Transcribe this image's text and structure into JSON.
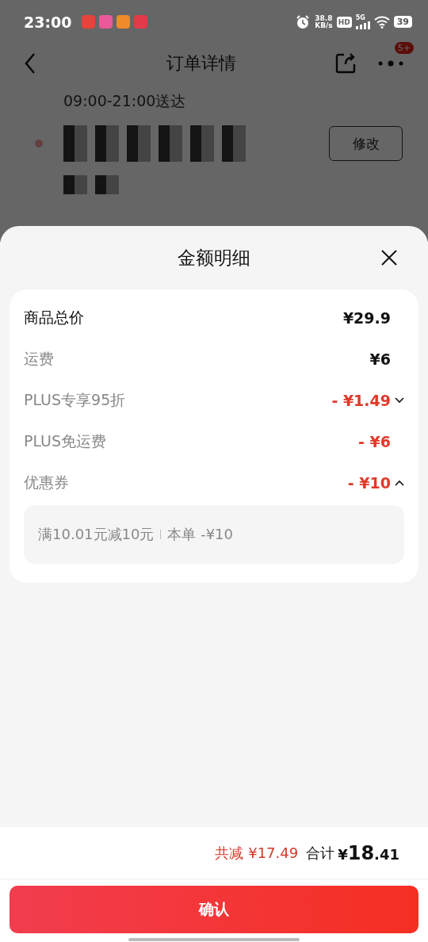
{
  "status_bar": {
    "time": "23:00",
    "speed_value": "38.8",
    "speed_unit": "KB/s",
    "hd": "HD",
    "network": "5G",
    "battery": "39"
  },
  "header": {
    "title": "订单详情",
    "badge": "5+"
  },
  "background": {
    "delivery_time": "09:00-21:00送达",
    "edit_button": "修改"
  },
  "sheet": {
    "title": "金额明细",
    "rows": [
      {
        "label": "商品总价",
        "amount": "¥29.9",
        "kind": "total",
        "discount": false
      },
      {
        "label": "运费",
        "amount": "¥6",
        "kind": "plain",
        "discount": false
      },
      {
        "label": "PLUS专享95折",
        "amount": "- ¥1.49",
        "kind": "expandable",
        "discount": true,
        "expanded": false
      },
      {
        "label": "PLUS免运费",
        "amount": "- ¥6",
        "kind": "plain",
        "discount": true
      },
      {
        "label": "优惠券",
        "amount": "- ¥10",
        "kind": "expandable",
        "discount": true,
        "expanded": true,
        "detail": {
          "condition": "满10.01元减10元",
          "applied": "本单 -¥10"
        }
      }
    ]
  },
  "footer": {
    "saved": "共减 ¥17.49",
    "total_label": "合计",
    "total_currency": "¥",
    "total_integer": "18",
    "total_fraction": ".41",
    "confirm_button": "确认"
  }
}
